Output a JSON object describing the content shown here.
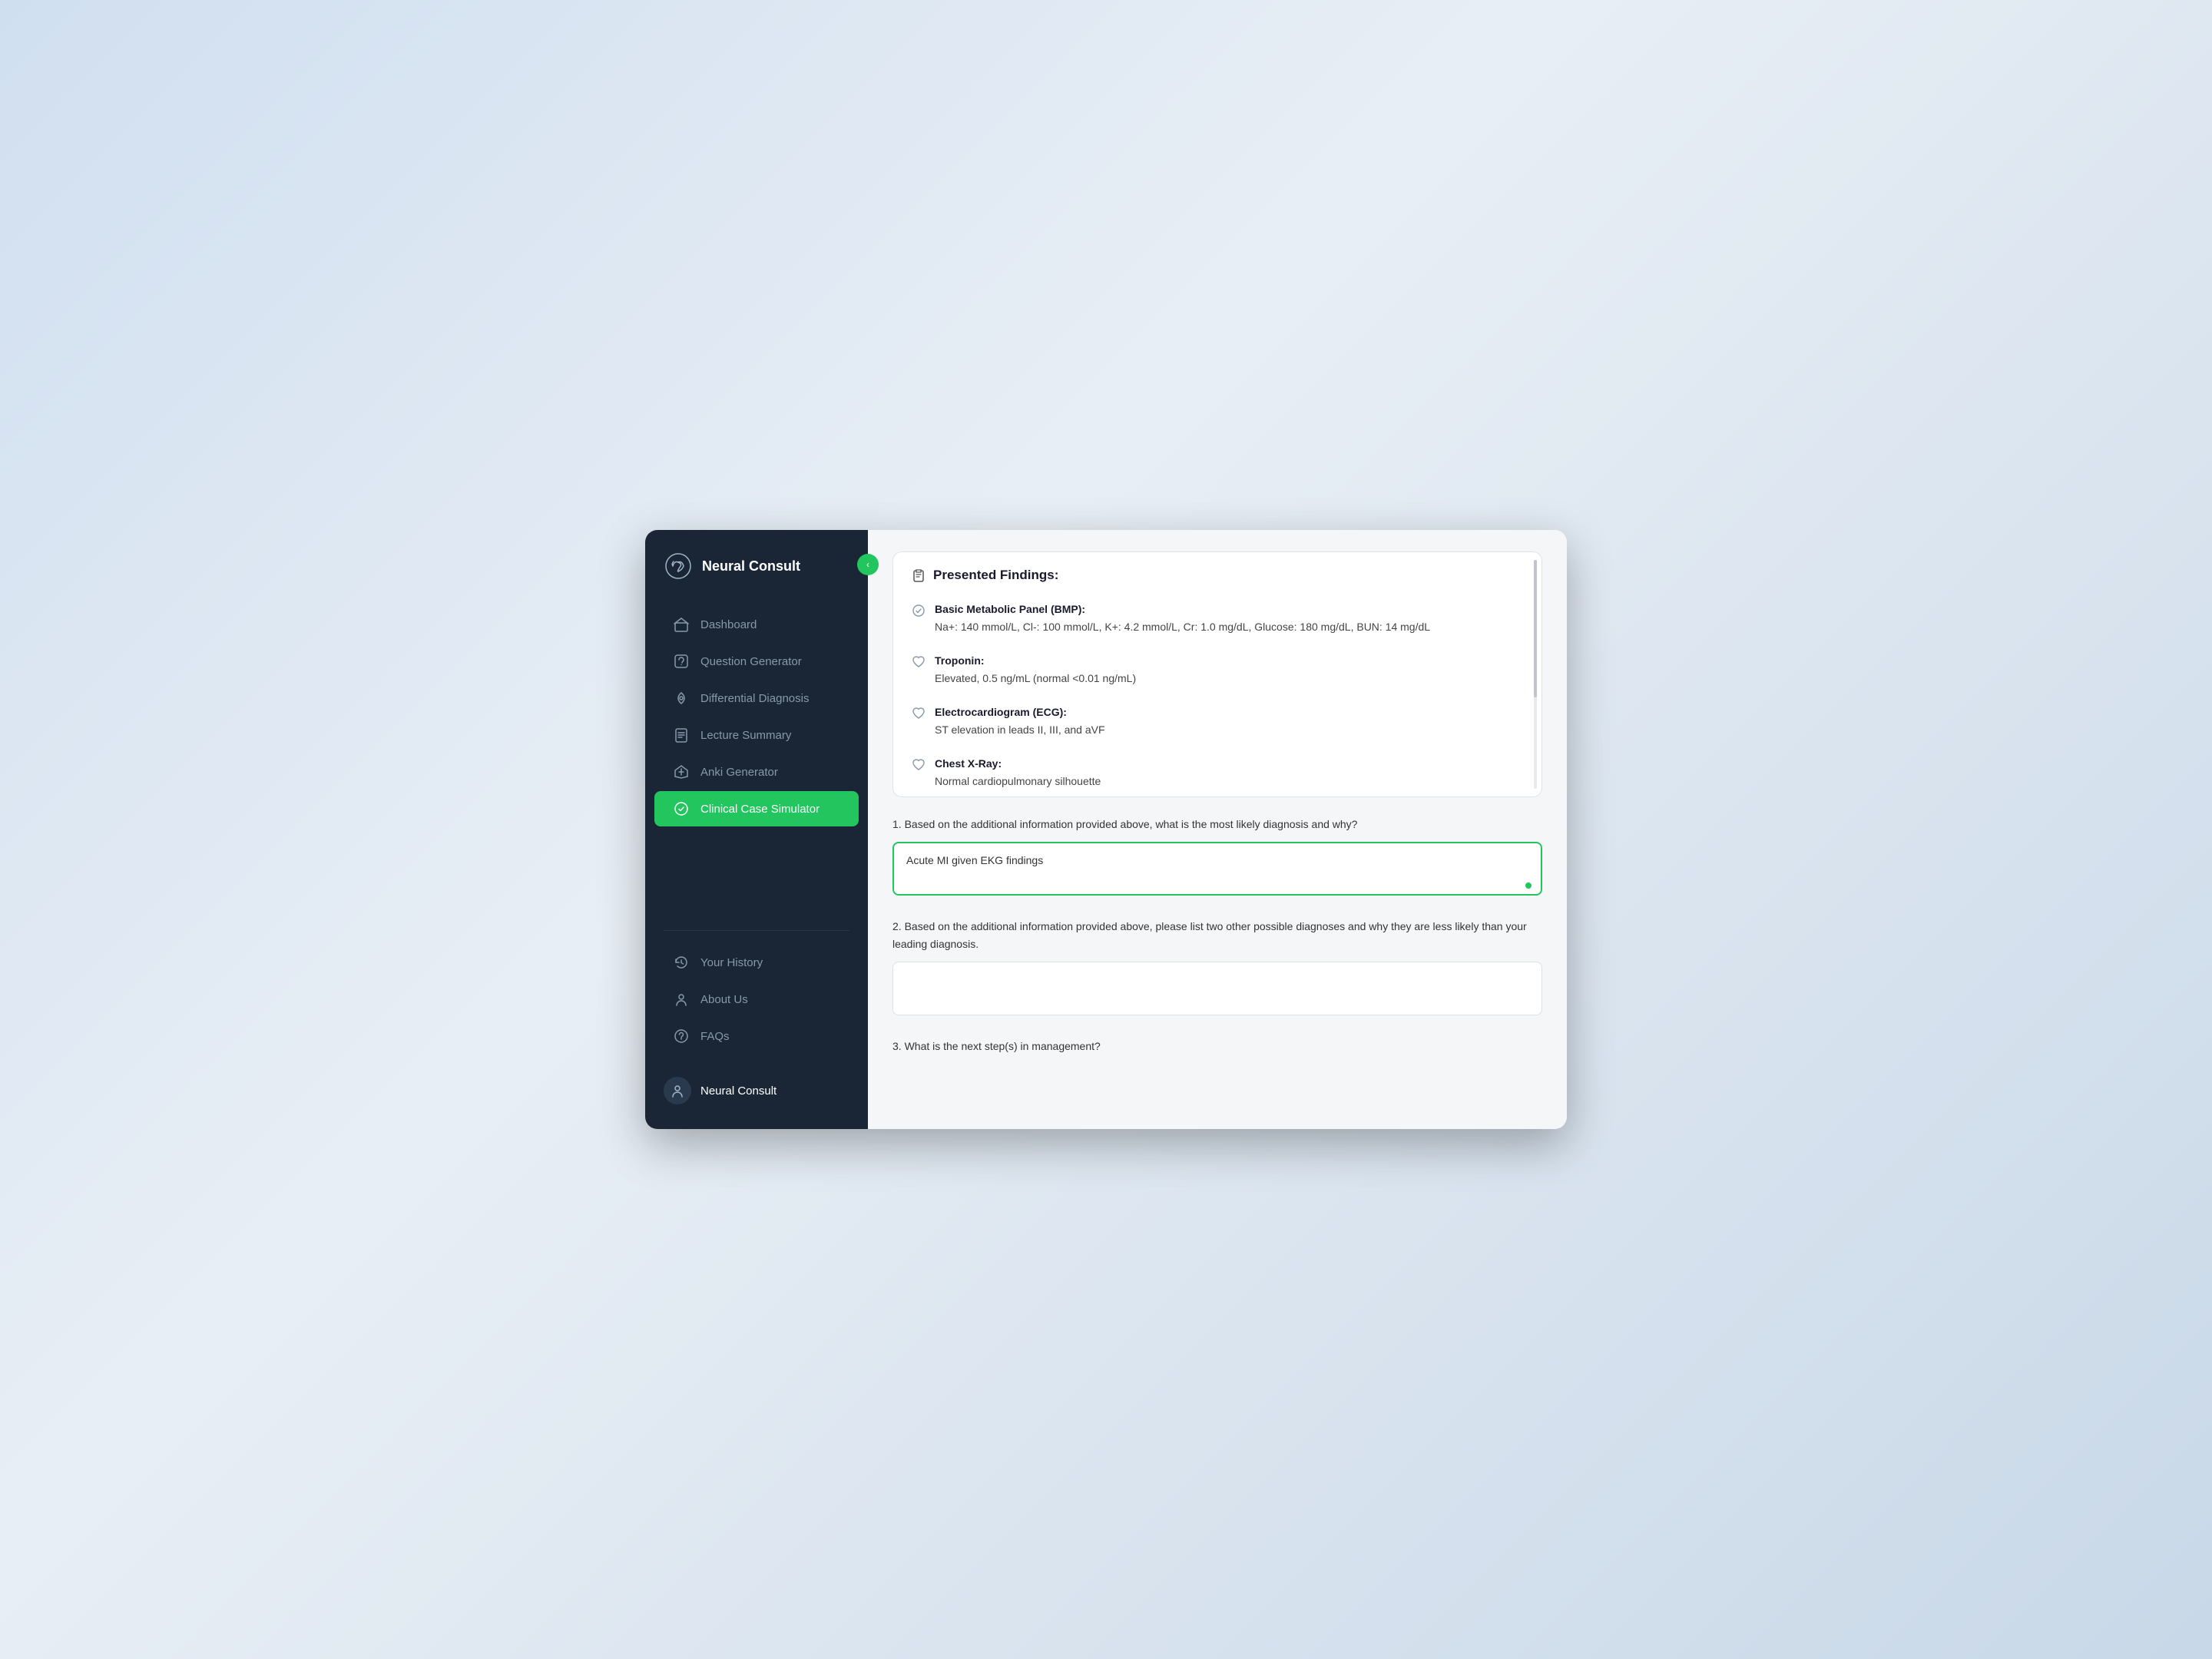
{
  "app": {
    "title": "Neural Consult"
  },
  "sidebar": {
    "collapse_btn": "‹",
    "items": [
      {
        "id": "dashboard",
        "label": "Dashboard",
        "active": false
      },
      {
        "id": "question-generator",
        "label": "Question Generator",
        "active": false
      },
      {
        "id": "differential-diagnosis",
        "label": "Differential Diagnosis",
        "active": false
      },
      {
        "id": "lecture-summary",
        "label": "Lecture Summary",
        "active": false
      },
      {
        "id": "anki-generator",
        "label": "Anki Generator",
        "active": false
      },
      {
        "id": "clinical-case-simulator",
        "label": "Clinical Case Simulator",
        "active": true
      }
    ],
    "divider": true,
    "bottom_items": [
      {
        "id": "your-history",
        "label": "Your History"
      },
      {
        "id": "about-us",
        "label": "About Us"
      },
      {
        "id": "faqs",
        "label": "FAQs"
      }
    ],
    "user": {
      "name": "Neural Consult"
    }
  },
  "main": {
    "findings_title": "Presented Findings:",
    "findings": [
      {
        "id": "bmp",
        "name": "Basic Metabolic Panel (BMP):",
        "value": "Na+: 140 mmol/L, Cl-: 100 mmol/L, K+: 4.2 mmol/L, Cr: 1.0 mg/dL, Glucose: 180 mg/dL, BUN: 14 mg/dL",
        "icon": "check"
      },
      {
        "id": "troponin",
        "name": "Troponin:",
        "value": "Elevated, 0.5 ng/mL (normal <0.01 ng/mL)",
        "icon": "heart"
      },
      {
        "id": "ecg",
        "name": "Electrocardiogram (ECG):",
        "value": "ST elevation in leads II, III, and aVF",
        "icon": "heart"
      },
      {
        "id": "chest-xray",
        "name": "Chest X-Ray:",
        "value": "Normal cardiopulmonary silhouette",
        "icon": "heart"
      }
    ],
    "questions": [
      {
        "id": "q1",
        "number": "1",
        "text": "Based on the additional information provided above, what is the most likely diagnosis and why?",
        "answer": "Acute MI given EKG findings",
        "has_answer": true
      },
      {
        "id": "q2",
        "number": "2",
        "text": "Based on the additional information provided above, please list two other possible diagnoses and why they are less likely than your leading diagnosis.",
        "answer": "",
        "has_answer": false
      },
      {
        "id": "q3",
        "number": "3",
        "text": "What is the next step(s) in management?",
        "answer": "",
        "has_answer": false
      }
    ]
  }
}
